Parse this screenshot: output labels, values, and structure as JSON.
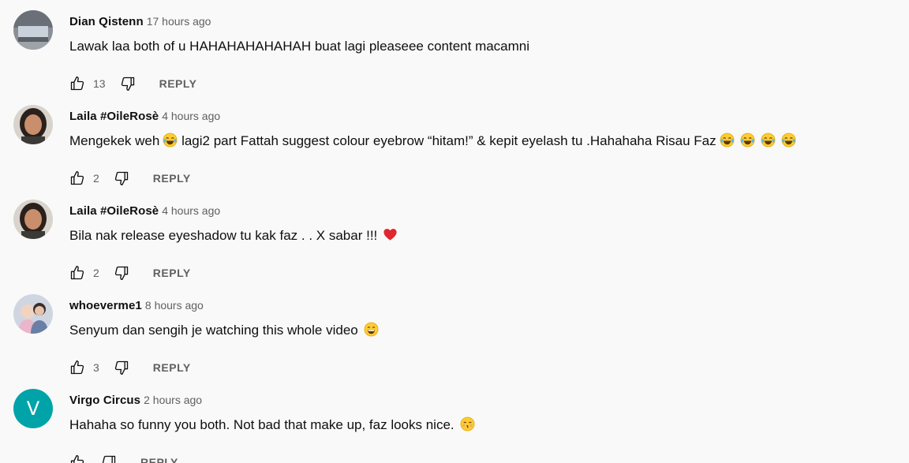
{
  "reply_label": "REPLY",
  "comments": [
    {
      "author": "Dian Qistenn",
      "time": "17 hours ago",
      "text": "Lawak laa both of u HAHAHAHAHAHAH buat lagi pleaseee content macamni",
      "likes": "13",
      "avatar": "landscape-photo",
      "emojis": []
    },
    {
      "author": "Laila #OileRosè",
      "time": "4 hours ago",
      "text": "Mengekek weh 😂 lagi2 part Fattah suggest colour eyebrow “hitam!” & kepit eyelash tu .Hahahaha Risau Faz 😂 😂 😂 😂",
      "text_before": "Mengekek weh",
      "text_middle": " lagi2 part Fattah suggest colour eyebrow “hitam!” & kepit eyelash tu .Hahahaha Risau Faz",
      "likes": "2",
      "avatar": "portrait-photo",
      "emojis": [
        "tears-of-joy-emoji",
        "tears-of-joy-emoji",
        "tears-of-joy-emoji",
        "tears-of-joy-emoji",
        "tears-of-joy-emoji"
      ]
    },
    {
      "author": "Laila #OileRosè",
      "time": "4 hours ago",
      "text": "Bila nak release eyeshadow tu kak faz . . X sabar !!! ❤️",
      "text_before": "Bila nak release eyeshadow tu kak faz . . X sabar !!!",
      "likes": "2",
      "avatar": "portrait-photo",
      "emojis": [
        "red-heart-emoji"
      ]
    },
    {
      "author": "whoeverme1",
      "time": "8 hours ago",
      "text": "Senyum dan sengih je watching this whole video 😄",
      "text_before": "Senyum dan sengih je watching this whole video",
      "likes": "3",
      "avatar": "couple-photo",
      "emojis": [
        "grinning-emoji"
      ]
    },
    {
      "author": "Virgo Circus",
      "time": "2 hours ago",
      "text": "Hahaha so funny you both. Not bad that make up, faz looks nice. 😚",
      "text_before": "Hahaha so funny you both. Not bad that make up, faz looks nice.",
      "likes": "",
      "avatar_letter": "V",
      "avatar_color": "#00a3a8",
      "emojis": [
        "kissing-emoji"
      ]
    }
  ],
  "colors": {
    "background": "#f9f9f9",
    "text": "#0f0f0f",
    "secondary_text": "#606060",
    "accent_avatar": "#00a3a8"
  }
}
